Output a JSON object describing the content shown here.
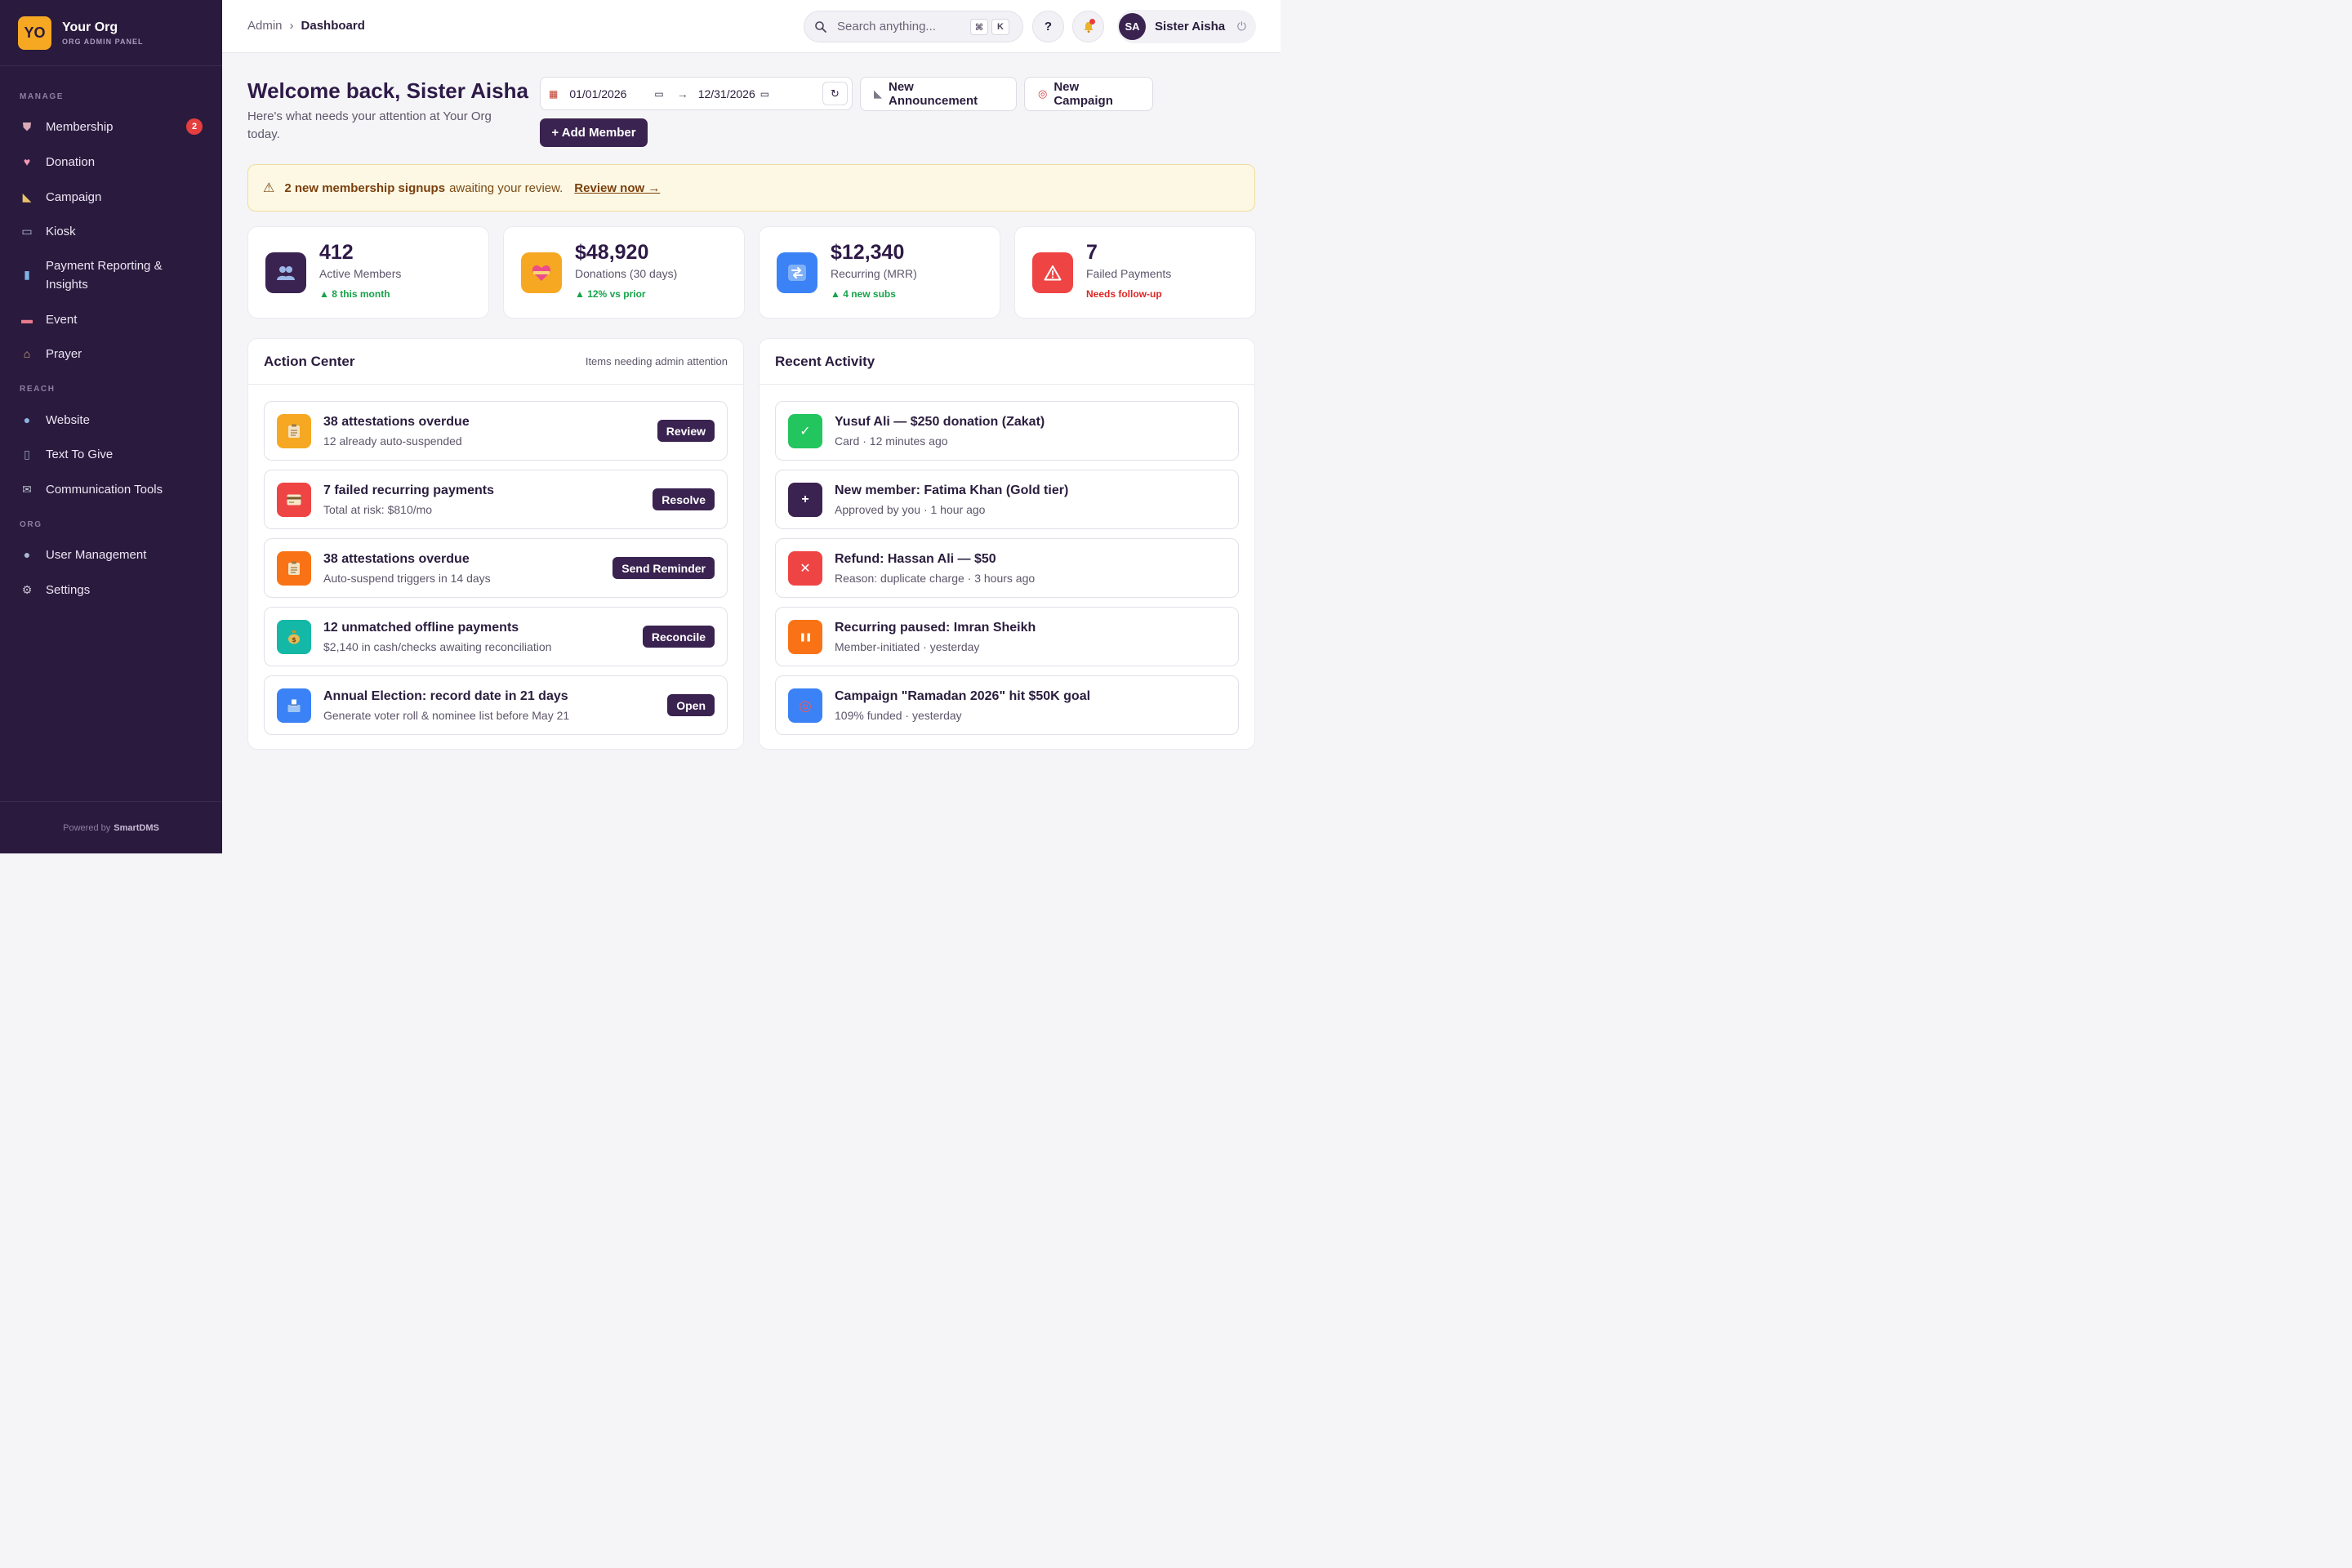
{
  "brand": {
    "logo": "YO",
    "name": "Your Org",
    "subtitle": "ORG ADMIN PANEL"
  },
  "sidebar": {
    "sections": [
      {
        "label": "MANAGE"
      },
      {
        "label": "REACH"
      },
      {
        "label": "ORG"
      }
    ],
    "items": [
      {
        "label": "Membership",
        "icon": "shield-icon",
        "badge": "2"
      },
      {
        "label": "Donation",
        "icon": "heart-icon"
      },
      {
        "label": "Campaign",
        "icon": "megaphone-icon"
      },
      {
        "label": "Kiosk",
        "icon": "monitor-icon"
      },
      {
        "label": "Payment Reporting & Insights",
        "icon": "bar-chart-icon"
      },
      {
        "label": "Event",
        "icon": "ticket-icon"
      },
      {
        "label": "Prayer",
        "icon": "mosque-icon"
      },
      {
        "label": "Website",
        "icon": "globe-icon"
      },
      {
        "label": "Text To Give",
        "icon": "phone-icon"
      },
      {
        "label": "Communication Tools",
        "icon": "envelope-icon"
      },
      {
        "label": "User Management",
        "icon": "user-icon"
      },
      {
        "label": "Settings",
        "icon": "gear-icon"
      }
    ],
    "footer": {
      "prefix": "Powered by",
      "brand": "SmartDMS"
    }
  },
  "topbar": {
    "breadcrumb": [
      "Admin",
      "Dashboard"
    ],
    "search_placeholder": "Search anything...",
    "shortcut": [
      "⌘",
      "K"
    ],
    "help": "?",
    "user": {
      "initials": "SA",
      "name": "Sister Aisha"
    }
  },
  "welcome": {
    "title": "Welcome back, Sister Aisha",
    "subtitle": "Here's what needs your attention at Your Org today."
  },
  "date_range": {
    "start": "01/01/2026",
    "end": "12/31/2026"
  },
  "actions": {
    "announcement": "New Announcement",
    "campaign": "New Campaign",
    "add_member": "+ Add Member"
  },
  "alert": {
    "bold": "2 new membership signups",
    "text": "awaiting your review.",
    "link": "Review now →"
  },
  "stats": [
    {
      "value": "412",
      "label": "Active Members",
      "trend": "▲ 8 this month",
      "color": "#3a2350",
      "trend_color": "#16a34a",
      "icon": "people-icon"
    },
    {
      "value": "$48,920",
      "label": "Donations (30 days)",
      "trend": "▲ 12% vs prior",
      "color": "#f6a823",
      "trend_color": "#16a34a",
      "icon": "heart-icon"
    },
    {
      "value": "$12,340",
      "label": "Recurring (MRR)",
      "trend": "▲ 4 new subs",
      "color": "#3b82f6",
      "trend_color": "#16a34a",
      "icon": "repeat-icon"
    },
    {
      "value": "7",
      "label": "Failed Payments",
      "trend": "Needs follow-up",
      "color": "#ef4444",
      "trend_color": "#dc2626",
      "icon": "warning-icon"
    }
  ],
  "action_center": {
    "title": "Action Center",
    "subtitle": "Items needing admin attention",
    "items": [
      {
        "title": "38 attestations overdue",
        "sub": "12 already auto-suspended",
        "button": "Review",
        "color": "#f6a823",
        "icon": "clipboard-icon"
      },
      {
        "title": "7 failed recurring payments",
        "sub": "Total at risk: $810/mo",
        "button": "Resolve",
        "color": "#ef4444",
        "icon": "credit-card-icon"
      },
      {
        "title": "38 attestations overdue",
        "sub": "Auto-suspend triggers in 14 days",
        "button": "Send Reminder",
        "color": "#f97316",
        "icon": "clipboard-icon"
      },
      {
        "title": "12 unmatched offline payments",
        "sub": "$2,140 in cash/checks awaiting reconciliation",
        "button": "Reconcile",
        "color": "#14b8a6",
        "icon": "money-bag-icon"
      },
      {
        "title": "Annual Election: record date in 21 days",
        "sub": "Generate voter roll & nominee list before May 21",
        "button": "Open",
        "color": "#3b82f6",
        "icon": "ballot-box-icon"
      }
    ]
  },
  "recent_activity": {
    "title": "Recent Activity",
    "items": [
      {
        "title": "Yusuf Ali — $250 donation (Zakat)",
        "sub": "Card · 12 minutes ago",
        "color": "#22c55e",
        "icon": "check-icon",
        "glyph": "✓"
      },
      {
        "title": "New member: Fatima Khan (Gold tier)",
        "sub": "Approved by you · 1 hour ago",
        "color": "#3a2350",
        "icon": "plus-icon",
        "glyph": "+"
      },
      {
        "title": "Refund: Hassan Ali — $50",
        "sub": "Reason: duplicate charge · 3 hours ago",
        "color": "#ef4444",
        "icon": "close-icon",
        "glyph": "✕"
      },
      {
        "title": "Recurring paused: Imran Sheikh",
        "sub": "Member-initiated · yesterday",
        "color": "#f97316",
        "icon": "pause-icon",
        "glyph": "❚❚"
      },
      {
        "title": "Campaign \"Ramadan 2026\" hit $50K goal",
        "sub": "109% funded · yesterday",
        "color": "#3b82f6",
        "icon": "target-icon",
        "glyph": "◎"
      }
    ]
  }
}
